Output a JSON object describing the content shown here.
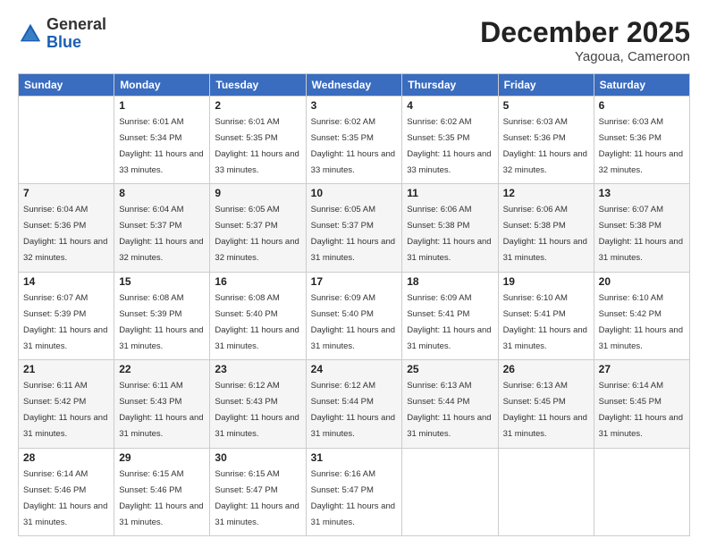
{
  "logo": {
    "general": "General",
    "blue": "Blue"
  },
  "header": {
    "month": "December 2025",
    "location": "Yagoua, Cameroon"
  },
  "weekdays": [
    "Sunday",
    "Monday",
    "Tuesday",
    "Wednesday",
    "Thursday",
    "Friday",
    "Saturday"
  ],
  "weeks": [
    [
      {
        "day": "",
        "sunrise": "",
        "sunset": "",
        "daylight": ""
      },
      {
        "day": "1",
        "sunrise": "Sunrise: 6:01 AM",
        "sunset": "Sunset: 5:34 PM",
        "daylight": "Daylight: 11 hours and 33 minutes."
      },
      {
        "day": "2",
        "sunrise": "Sunrise: 6:01 AM",
        "sunset": "Sunset: 5:35 PM",
        "daylight": "Daylight: 11 hours and 33 minutes."
      },
      {
        "day": "3",
        "sunrise": "Sunrise: 6:02 AM",
        "sunset": "Sunset: 5:35 PM",
        "daylight": "Daylight: 11 hours and 33 minutes."
      },
      {
        "day": "4",
        "sunrise": "Sunrise: 6:02 AM",
        "sunset": "Sunset: 5:35 PM",
        "daylight": "Daylight: 11 hours and 33 minutes."
      },
      {
        "day": "5",
        "sunrise": "Sunrise: 6:03 AM",
        "sunset": "Sunset: 5:36 PM",
        "daylight": "Daylight: 11 hours and 32 minutes."
      },
      {
        "day": "6",
        "sunrise": "Sunrise: 6:03 AM",
        "sunset": "Sunset: 5:36 PM",
        "daylight": "Daylight: 11 hours and 32 minutes."
      }
    ],
    [
      {
        "day": "7",
        "sunrise": "Sunrise: 6:04 AM",
        "sunset": "Sunset: 5:36 PM",
        "daylight": "Daylight: 11 hours and 32 minutes."
      },
      {
        "day": "8",
        "sunrise": "Sunrise: 6:04 AM",
        "sunset": "Sunset: 5:37 PM",
        "daylight": "Daylight: 11 hours and 32 minutes."
      },
      {
        "day": "9",
        "sunrise": "Sunrise: 6:05 AM",
        "sunset": "Sunset: 5:37 PM",
        "daylight": "Daylight: 11 hours and 32 minutes."
      },
      {
        "day": "10",
        "sunrise": "Sunrise: 6:05 AM",
        "sunset": "Sunset: 5:37 PM",
        "daylight": "Daylight: 11 hours and 31 minutes."
      },
      {
        "day": "11",
        "sunrise": "Sunrise: 6:06 AM",
        "sunset": "Sunset: 5:38 PM",
        "daylight": "Daylight: 11 hours and 31 minutes."
      },
      {
        "day": "12",
        "sunrise": "Sunrise: 6:06 AM",
        "sunset": "Sunset: 5:38 PM",
        "daylight": "Daylight: 11 hours and 31 minutes."
      },
      {
        "day": "13",
        "sunrise": "Sunrise: 6:07 AM",
        "sunset": "Sunset: 5:38 PM",
        "daylight": "Daylight: 11 hours and 31 minutes."
      }
    ],
    [
      {
        "day": "14",
        "sunrise": "Sunrise: 6:07 AM",
        "sunset": "Sunset: 5:39 PM",
        "daylight": "Daylight: 11 hours and 31 minutes."
      },
      {
        "day": "15",
        "sunrise": "Sunrise: 6:08 AM",
        "sunset": "Sunset: 5:39 PM",
        "daylight": "Daylight: 11 hours and 31 minutes."
      },
      {
        "day": "16",
        "sunrise": "Sunrise: 6:08 AM",
        "sunset": "Sunset: 5:40 PM",
        "daylight": "Daylight: 11 hours and 31 minutes."
      },
      {
        "day": "17",
        "sunrise": "Sunrise: 6:09 AM",
        "sunset": "Sunset: 5:40 PM",
        "daylight": "Daylight: 11 hours and 31 minutes."
      },
      {
        "day": "18",
        "sunrise": "Sunrise: 6:09 AM",
        "sunset": "Sunset: 5:41 PM",
        "daylight": "Daylight: 11 hours and 31 minutes."
      },
      {
        "day": "19",
        "sunrise": "Sunrise: 6:10 AM",
        "sunset": "Sunset: 5:41 PM",
        "daylight": "Daylight: 11 hours and 31 minutes."
      },
      {
        "day": "20",
        "sunrise": "Sunrise: 6:10 AM",
        "sunset": "Sunset: 5:42 PM",
        "daylight": "Daylight: 11 hours and 31 minutes."
      }
    ],
    [
      {
        "day": "21",
        "sunrise": "Sunrise: 6:11 AM",
        "sunset": "Sunset: 5:42 PM",
        "daylight": "Daylight: 11 hours and 31 minutes."
      },
      {
        "day": "22",
        "sunrise": "Sunrise: 6:11 AM",
        "sunset": "Sunset: 5:43 PM",
        "daylight": "Daylight: 11 hours and 31 minutes."
      },
      {
        "day": "23",
        "sunrise": "Sunrise: 6:12 AM",
        "sunset": "Sunset: 5:43 PM",
        "daylight": "Daylight: 11 hours and 31 minutes."
      },
      {
        "day": "24",
        "sunrise": "Sunrise: 6:12 AM",
        "sunset": "Sunset: 5:44 PM",
        "daylight": "Daylight: 11 hours and 31 minutes."
      },
      {
        "day": "25",
        "sunrise": "Sunrise: 6:13 AM",
        "sunset": "Sunset: 5:44 PM",
        "daylight": "Daylight: 11 hours and 31 minutes."
      },
      {
        "day": "26",
        "sunrise": "Sunrise: 6:13 AM",
        "sunset": "Sunset: 5:45 PM",
        "daylight": "Daylight: 11 hours and 31 minutes."
      },
      {
        "day": "27",
        "sunrise": "Sunrise: 6:14 AM",
        "sunset": "Sunset: 5:45 PM",
        "daylight": "Daylight: 11 hours and 31 minutes."
      }
    ],
    [
      {
        "day": "28",
        "sunrise": "Sunrise: 6:14 AM",
        "sunset": "Sunset: 5:46 PM",
        "daylight": "Daylight: 11 hours and 31 minutes."
      },
      {
        "day": "29",
        "sunrise": "Sunrise: 6:15 AM",
        "sunset": "Sunset: 5:46 PM",
        "daylight": "Daylight: 11 hours and 31 minutes."
      },
      {
        "day": "30",
        "sunrise": "Sunrise: 6:15 AM",
        "sunset": "Sunset: 5:47 PM",
        "daylight": "Daylight: 11 hours and 31 minutes."
      },
      {
        "day": "31",
        "sunrise": "Sunrise: 6:16 AM",
        "sunset": "Sunset: 5:47 PM",
        "daylight": "Daylight: 11 hours and 31 minutes."
      },
      {
        "day": "",
        "sunrise": "",
        "sunset": "",
        "daylight": ""
      },
      {
        "day": "",
        "sunrise": "",
        "sunset": "",
        "daylight": ""
      },
      {
        "day": "",
        "sunrise": "",
        "sunset": "",
        "daylight": ""
      }
    ]
  ]
}
